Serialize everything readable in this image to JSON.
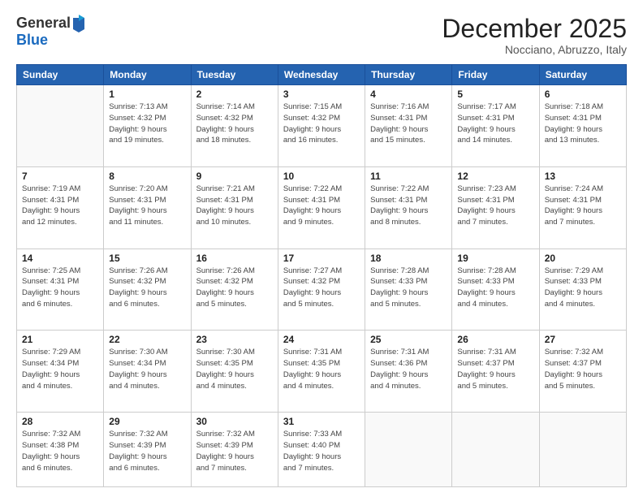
{
  "logo": {
    "general": "General",
    "blue": "Blue"
  },
  "header": {
    "month": "December 2025",
    "location": "Nocciano, Abruzzo, Italy"
  },
  "days_of_week": [
    "Sunday",
    "Monday",
    "Tuesday",
    "Wednesday",
    "Thursday",
    "Friday",
    "Saturday"
  ],
  "weeks": [
    [
      {
        "day": "",
        "info": ""
      },
      {
        "day": "1",
        "info": "Sunrise: 7:13 AM\nSunset: 4:32 PM\nDaylight: 9 hours\nand 19 minutes."
      },
      {
        "day": "2",
        "info": "Sunrise: 7:14 AM\nSunset: 4:32 PM\nDaylight: 9 hours\nand 18 minutes."
      },
      {
        "day": "3",
        "info": "Sunrise: 7:15 AM\nSunset: 4:32 PM\nDaylight: 9 hours\nand 16 minutes."
      },
      {
        "day": "4",
        "info": "Sunrise: 7:16 AM\nSunset: 4:31 PM\nDaylight: 9 hours\nand 15 minutes."
      },
      {
        "day": "5",
        "info": "Sunrise: 7:17 AM\nSunset: 4:31 PM\nDaylight: 9 hours\nand 14 minutes."
      },
      {
        "day": "6",
        "info": "Sunrise: 7:18 AM\nSunset: 4:31 PM\nDaylight: 9 hours\nand 13 minutes."
      }
    ],
    [
      {
        "day": "7",
        "info": "Sunrise: 7:19 AM\nSunset: 4:31 PM\nDaylight: 9 hours\nand 12 minutes."
      },
      {
        "day": "8",
        "info": "Sunrise: 7:20 AM\nSunset: 4:31 PM\nDaylight: 9 hours\nand 11 minutes."
      },
      {
        "day": "9",
        "info": "Sunrise: 7:21 AM\nSunset: 4:31 PM\nDaylight: 9 hours\nand 10 minutes."
      },
      {
        "day": "10",
        "info": "Sunrise: 7:22 AM\nSunset: 4:31 PM\nDaylight: 9 hours\nand 9 minutes."
      },
      {
        "day": "11",
        "info": "Sunrise: 7:22 AM\nSunset: 4:31 PM\nDaylight: 9 hours\nand 8 minutes."
      },
      {
        "day": "12",
        "info": "Sunrise: 7:23 AM\nSunset: 4:31 PM\nDaylight: 9 hours\nand 7 minutes."
      },
      {
        "day": "13",
        "info": "Sunrise: 7:24 AM\nSunset: 4:31 PM\nDaylight: 9 hours\nand 7 minutes."
      }
    ],
    [
      {
        "day": "14",
        "info": "Sunrise: 7:25 AM\nSunset: 4:31 PM\nDaylight: 9 hours\nand 6 minutes."
      },
      {
        "day": "15",
        "info": "Sunrise: 7:26 AM\nSunset: 4:32 PM\nDaylight: 9 hours\nand 6 minutes."
      },
      {
        "day": "16",
        "info": "Sunrise: 7:26 AM\nSunset: 4:32 PM\nDaylight: 9 hours\nand 5 minutes."
      },
      {
        "day": "17",
        "info": "Sunrise: 7:27 AM\nSunset: 4:32 PM\nDaylight: 9 hours\nand 5 minutes."
      },
      {
        "day": "18",
        "info": "Sunrise: 7:28 AM\nSunset: 4:33 PM\nDaylight: 9 hours\nand 5 minutes."
      },
      {
        "day": "19",
        "info": "Sunrise: 7:28 AM\nSunset: 4:33 PM\nDaylight: 9 hours\nand 4 minutes."
      },
      {
        "day": "20",
        "info": "Sunrise: 7:29 AM\nSunset: 4:33 PM\nDaylight: 9 hours\nand 4 minutes."
      }
    ],
    [
      {
        "day": "21",
        "info": "Sunrise: 7:29 AM\nSunset: 4:34 PM\nDaylight: 9 hours\nand 4 minutes."
      },
      {
        "day": "22",
        "info": "Sunrise: 7:30 AM\nSunset: 4:34 PM\nDaylight: 9 hours\nand 4 minutes."
      },
      {
        "day": "23",
        "info": "Sunrise: 7:30 AM\nSunset: 4:35 PM\nDaylight: 9 hours\nand 4 minutes."
      },
      {
        "day": "24",
        "info": "Sunrise: 7:31 AM\nSunset: 4:35 PM\nDaylight: 9 hours\nand 4 minutes."
      },
      {
        "day": "25",
        "info": "Sunrise: 7:31 AM\nSunset: 4:36 PM\nDaylight: 9 hours\nand 4 minutes."
      },
      {
        "day": "26",
        "info": "Sunrise: 7:31 AM\nSunset: 4:37 PM\nDaylight: 9 hours\nand 5 minutes."
      },
      {
        "day": "27",
        "info": "Sunrise: 7:32 AM\nSunset: 4:37 PM\nDaylight: 9 hours\nand 5 minutes."
      }
    ],
    [
      {
        "day": "28",
        "info": "Sunrise: 7:32 AM\nSunset: 4:38 PM\nDaylight: 9 hours\nand 6 minutes."
      },
      {
        "day": "29",
        "info": "Sunrise: 7:32 AM\nSunset: 4:39 PM\nDaylight: 9 hours\nand 6 minutes."
      },
      {
        "day": "30",
        "info": "Sunrise: 7:32 AM\nSunset: 4:39 PM\nDaylight: 9 hours\nand 7 minutes."
      },
      {
        "day": "31",
        "info": "Sunrise: 7:33 AM\nSunset: 4:40 PM\nDaylight: 9 hours\nand 7 minutes."
      },
      {
        "day": "",
        "info": ""
      },
      {
        "day": "",
        "info": ""
      },
      {
        "day": "",
        "info": ""
      }
    ]
  ]
}
